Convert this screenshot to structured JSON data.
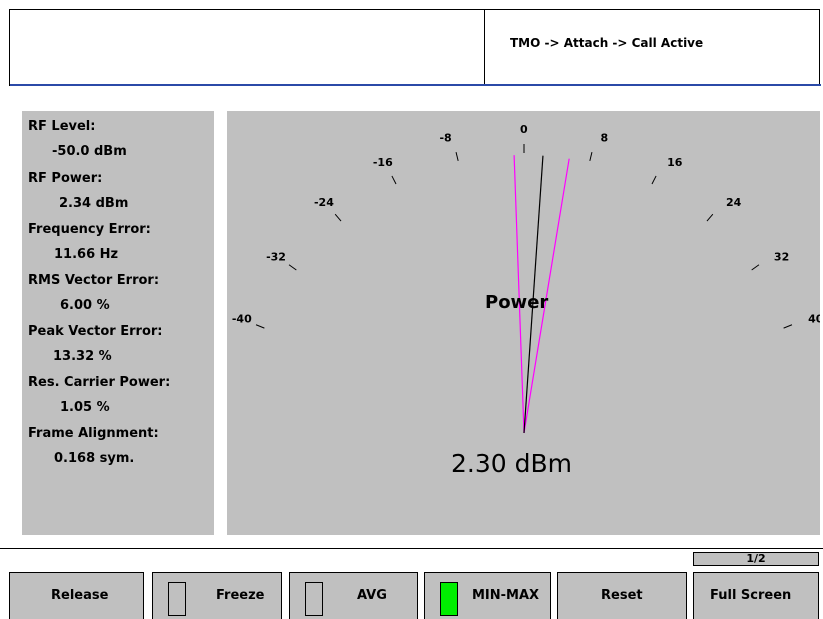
{
  "header": {
    "status": "TMO -> Attach -> Call Active"
  },
  "measurements": [
    {
      "label": "RF Level:",
      "value": "-50.0 dBm"
    },
    {
      "label": "RF Power:",
      "value": "2.34 dBm"
    },
    {
      "label": "Frequency Error:",
      "value": "11.66 Hz"
    },
    {
      "label": "RMS Vector Error:",
      "value": "6.00 %"
    },
    {
      "label": "Peak Vector Error:",
      "value": "13.32 %"
    },
    {
      "label": "Res. Carrier Power:",
      "value": "1.05 %"
    },
    {
      "label": "Frame Alignment:",
      "value": "0.168 sym."
    }
  ],
  "meter": {
    "title": "Power",
    "readout": "2.30 dBm",
    "scale_ticks": [
      "-40",
      "-32",
      "-24",
      "-16",
      "-8",
      "0",
      "8",
      "16",
      "24",
      "32",
      "40"
    ],
    "scale_min": -40,
    "scale_max": 40,
    "current_value": 2.3,
    "min_value": -1.2,
    "max_value": 5.5,
    "needle_color": "#000000",
    "minmax_color": "#ff00ff"
  },
  "page_indicator": "1/2",
  "softkeys": {
    "release": "Release",
    "freeze": "Freeze",
    "avg": "AVG",
    "minmax": "MIN-MAX",
    "reset": "Reset",
    "fullscreen": "Full Screen"
  },
  "colors": {
    "panel": "#c0c0c0",
    "header_underline": "#2b4aa8",
    "led_on": "#00ee00"
  }
}
